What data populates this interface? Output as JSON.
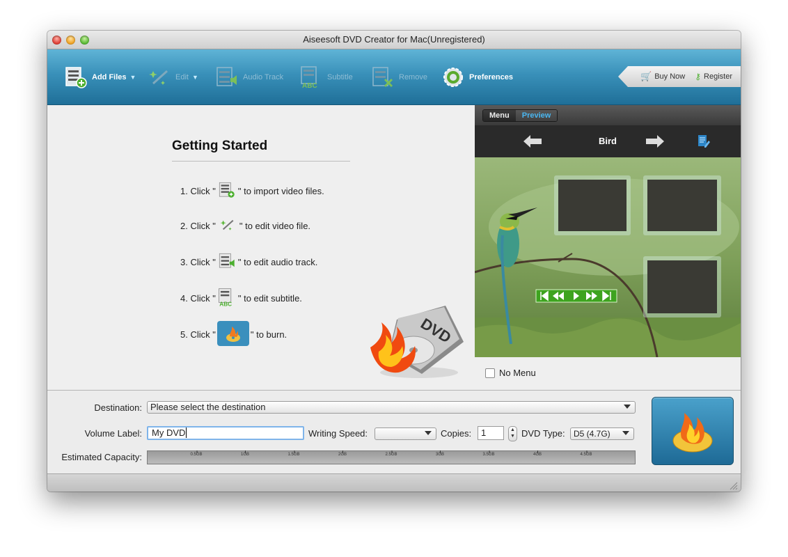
{
  "window": {
    "title": "Aiseesoft DVD Creator for Mac(Unregistered)"
  },
  "toolbar": {
    "add_files": "Add Files",
    "edit": "Edit",
    "audio_track": "Audio Track",
    "subtitle": "Subtitle",
    "remove": "Remove",
    "preferences": "Preferences",
    "buy_now": "Buy Now",
    "register": "Register"
  },
  "getting_started": {
    "title": "Getting Started",
    "steps": [
      {
        "prefix": "1. Click \"",
        "suffix": "\" to import video files.",
        "icon": "add-files-icon"
      },
      {
        "prefix": "2. Click \"",
        "suffix": "\" to edit video file.",
        "icon": "edit-wand-icon"
      },
      {
        "prefix": "3. Click \"",
        "suffix": "\" to edit audio track.",
        "icon": "audio-track-icon"
      },
      {
        "prefix": "4. Click \"",
        "suffix": "\" to edit subtitle.",
        "icon": "subtitle-icon"
      },
      {
        "prefix": "5. Click \"",
        "suffix": "\" to burn.",
        "icon": "burn-icon"
      }
    ]
  },
  "preview_panel": {
    "tabs": [
      "Menu",
      "Preview"
    ],
    "active_tab": "Preview",
    "template_name": "Bird",
    "no_menu_label": "No Menu",
    "no_menu_checked": false
  },
  "bottom": {
    "destination_label": "Destination:",
    "destination_value": "Please select the destination",
    "volume_label": "Volume Label:",
    "volume_value": "My DVD",
    "writing_speed_label": "Writing Speed:",
    "writing_speed_value": "",
    "copies_label": "Copies:",
    "copies_value": "1",
    "dvd_type_label": "DVD Type:",
    "dvd_type_value": "D5 (4.7G)",
    "capacity_label": "Estimated Capacity:",
    "capacity_ticks": [
      "0.5GB",
      "1GB",
      "1.5GB",
      "2GB",
      "2.5GB",
      "3GB",
      "3.5GB",
      "4GB",
      "4.5GB"
    ]
  },
  "colors": {
    "toolbar_blue": "#3990b9",
    "tab_active": "#4ab6f0",
    "focus_ring": "#7fb4ea"
  }
}
